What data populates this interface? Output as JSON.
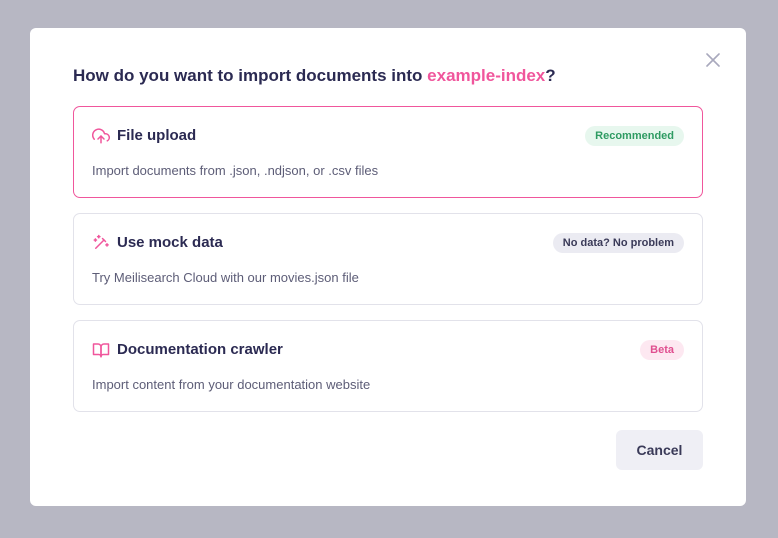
{
  "modal": {
    "title_prefix": "How do you want to import documents into ",
    "index_name": "example-index",
    "title_suffix": "?",
    "cancel_label": "Cancel"
  },
  "options": [
    {
      "name": "File upload",
      "description": "Import documents from .json, .ndjson, or .csv files",
      "badge": "Recommended",
      "icon": "cloud-upload-icon",
      "selected": true
    },
    {
      "name": "Use mock data",
      "description": "Try Meilisearch Cloud with our movies.json file",
      "badge": "No data? No problem",
      "icon": "magic-wand-icon",
      "selected": false
    },
    {
      "name": "Documentation crawler",
      "description": "Import content from your documentation website",
      "badge": "Beta",
      "icon": "book-icon",
      "selected": false
    }
  ],
  "colors": {
    "accent": "#f0569c",
    "text": "#2b2a52",
    "backdrop": "#b7b7c3"
  }
}
